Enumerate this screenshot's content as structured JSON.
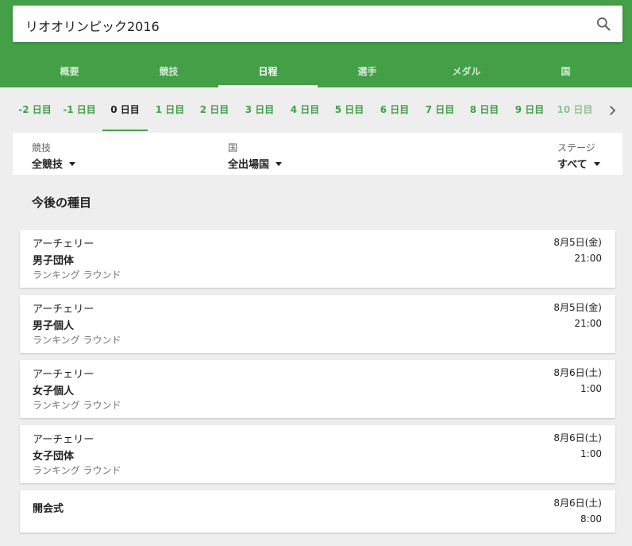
{
  "search": {
    "query": "リオオリンピック2016",
    "icon": "search-icon"
  },
  "tabs": [
    {
      "label": "概要",
      "active": false
    },
    {
      "label": "競技",
      "active": false
    },
    {
      "label": "日程",
      "active": true
    },
    {
      "label": "選手",
      "active": false
    },
    {
      "label": "メダル",
      "active": false
    },
    {
      "label": "国",
      "active": false
    }
  ],
  "days": [
    {
      "label": "-2 日目"
    },
    {
      "label": "-1 日目"
    },
    {
      "label": "0 日目",
      "active": true
    },
    {
      "label": "1 日目"
    },
    {
      "label": "2 日目"
    },
    {
      "label": "3 日目"
    },
    {
      "label": "4 日目"
    },
    {
      "label": "5 日目"
    },
    {
      "label": "6 日目"
    },
    {
      "label": "7 日目"
    },
    {
      "label": "8 日目"
    },
    {
      "label": "9 日目"
    },
    {
      "label": "10 日目"
    }
  ],
  "filters": {
    "sport": {
      "label": "競技",
      "value": "全競技"
    },
    "country": {
      "label": "国",
      "value": "全出場国"
    },
    "stage": {
      "label": "ステージ",
      "value": "すべて"
    }
  },
  "section_title": "今後の種目",
  "events": [
    {
      "sport": "アーチェリー",
      "event": "男子団体",
      "stage": "ランキング ラウンド",
      "date": "8月5日(金)",
      "time": "21:00"
    },
    {
      "sport": "アーチェリー",
      "event": "男子個人",
      "stage": "ランキング ラウンド",
      "date": "8月5日(金)",
      "time": "21:00"
    },
    {
      "sport": "アーチェリー",
      "event": "女子個人",
      "stage": "ランキング ラウンド",
      "date": "8月6日(土)",
      "time": "1:00"
    },
    {
      "sport": "アーチェリー",
      "event": "女子団体",
      "stage": "ランキング ラウンド",
      "date": "8月6日(土)",
      "time": "1:00"
    },
    {
      "sport": "",
      "event": "開会式",
      "stage": "",
      "date": "8月6日(土)",
      "time": "8:00"
    }
  ],
  "colors": {
    "accent": "#43a047",
    "background": "#eeeeee"
  }
}
